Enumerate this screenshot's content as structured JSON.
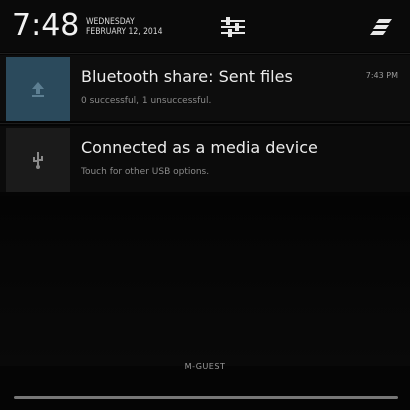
{
  "status": {
    "time": "7:48",
    "day": "WEDNESDAY",
    "date": "FEBRUARY 12, 2014"
  },
  "icons": {
    "quick_settings": "quick-settings-sliders-icon",
    "clear_all": "clear-all-notifications-icon",
    "bluetooth": "bluetooth-upload-icon",
    "usb": "usb-icon"
  },
  "notifications": [
    {
      "title": "Bluetooth share: Sent files",
      "subtitle": "0 successful, 1 unsuccessful.",
      "time": "7:43 PM"
    },
    {
      "title": "Connected as a media device",
      "subtitle": "Touch for other USB options."
    }
  ],
  "carrier_label": "M-GUEST",
  "colors": {
    "accent_icon_bg": "#2b4a5c",
    "background": "#050505"
  }
}
